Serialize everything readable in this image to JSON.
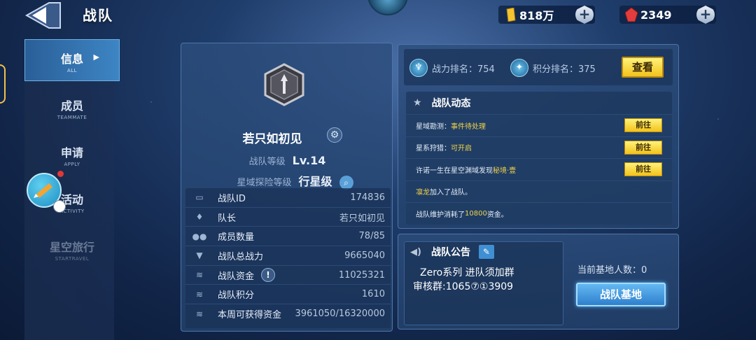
{
  "header": {
    "title": "战队"
  },
  "currency": [
    {
      "name": "gold",
      "value": "818万",
      "color": "#f4c430"
    },
    {
      "name": "gem",
      "value": "2349",
      "color": "#e23c3c"
    }
  ],
  "sidebar": {
    "items": [
      {
        "zh": "信息",
        "en": "ALL"
      },
      {
        "zh": "成员",
        "en": "TEAMMATE"
      },
      {
        "zh": "申请",
        "en": "APPLY"
      },
      {
        "zh": "活动",
        "en": "ACTIVITY"
      },
      {
        "zh": "星空旅行",
        "en": "STARTRAVEL"
      }
    ]
  },
  "team": {
    "name": "若只如初见",
    "level_label": "战队等级",
    "level_value": "Lv.14",
    "explore_label": "星域探险等级",
    "explore_value": "行星级"
  },
  "stats": [
    {
      "icon": "id-card-icon",
      "label": "战队ID",
      "value": "174836"
    },
    {
      "icon": "leader-icon",
      "label": "队长",
      "value": "若只如初见"
    },
    {
      "icon": "members-icon",
      "label": "成员数量",
      "value": "78/85"
    },
    {
      "icon": "power-icon",
      "label": "战队总战力",
      "value": "9665040"
    },
    {
      "icon": "coins-icon",
      "label": "战队资金",
      "value": "11025321"
    },
    {
      "icon": "coins-icon",
      "label": "战队积分",
      "value": "1610"
    },
    {
      "icon": "coins-icon",
      "label": "本周可获得资金",
      "value": "3961050/16320000"
    }
  ],
  "ranks": {
    "power_label": "战力排名：754",
    "points_label": "积分排名：375",
    "view_button": "查看"
  },
  "news": {
    "title": "战队动态",
    "go_label": "前往",
    "rows": [
      {
        "pre": "星域勘测：",
        "hl": "事件待处理",
        "post": ""
      },
      {
        "pre": "星系狩猎：",
        "hl": "可开启",
        "post": ""
      },
      {
        "pre": "许诺一生在星空渊域发现",
        "hl": "秘境·壹",
        "post": ""
      },
      {
        "pre": "",
        "hl": "凛龙",
        "post": "加入了战队。"
      },
      {
        "pre": "战队维护消耗了",
        "hl": "10800",
        "post": "资金。"
      }
    ]
  },
  "notice": {
    "title": "战队公告",
    "line1": "Zero系列   进队须加群",
    "line2": "审核群:1065⑦①3909"
  },
  "base": {
    "count_label": "当前基地人数：0",
    "button": "战队基地"
  }
}
